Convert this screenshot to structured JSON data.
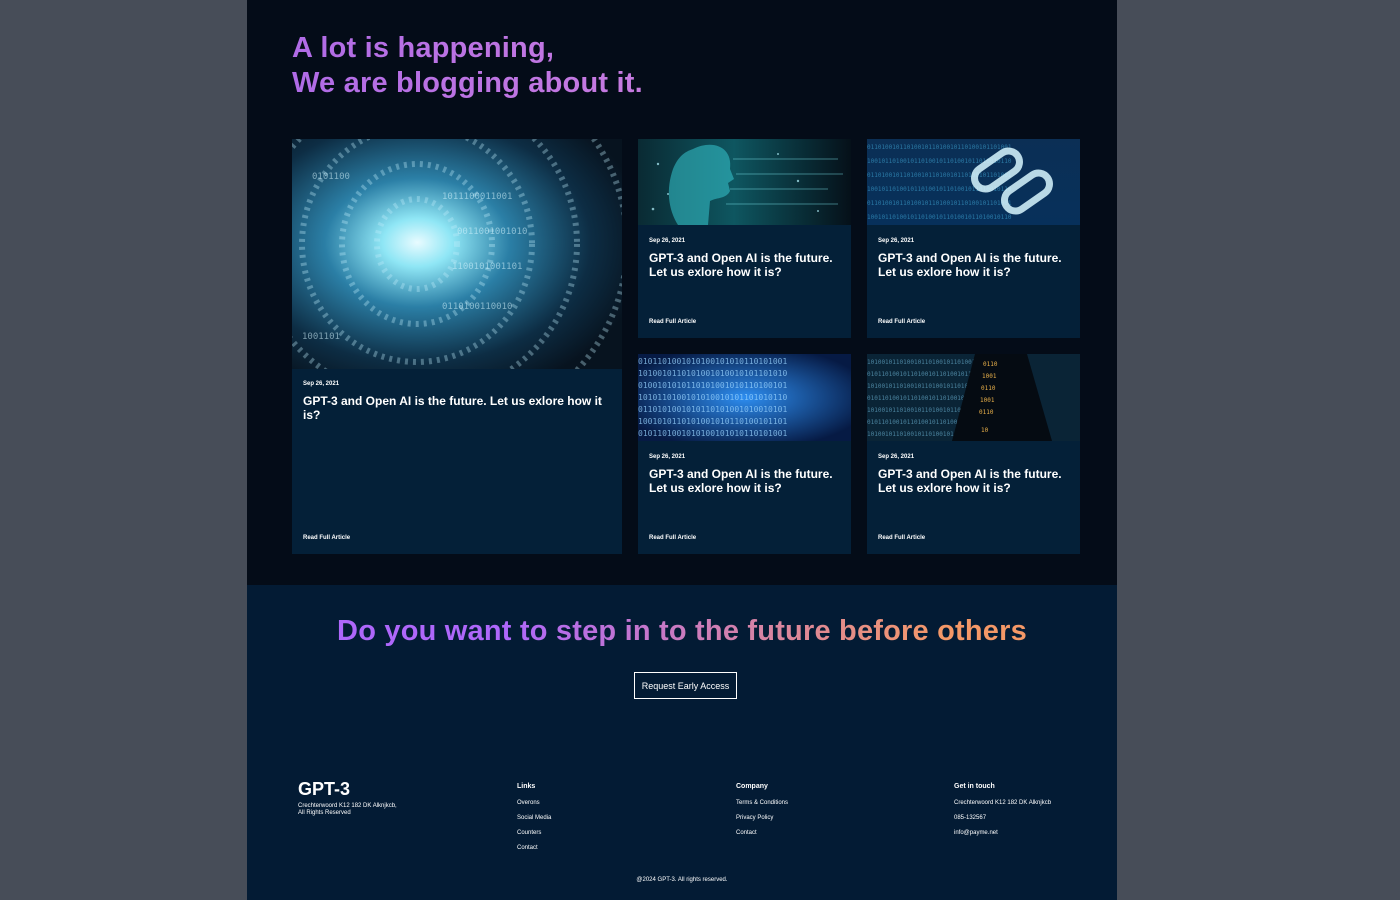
{
  "blog": {
    "title_line1": "A lot is happening,",
    "title_line2": "We are blogging about it.",
    "cards": [
      {
        "date": "Sep 26, 2021",
        "title": "GPT-3 and Open AI is the future. Let us exlore how it is?",
        "link": "Read Full Article",
        "image": "binary-tunnel-image"
      },
      {
        "date": "Sep 26, 2021",
        "title": "GPT-3 and Open AI is the future. Let us exlore how it is?",
        "link": "Read Full Article",
        "image": "ai-face-image"
      },
      {
        "date": "Sep 26, 2021",
        "title": "GPT-3 and Open AI is the future. Let us exlore how it is?",
        "link": "Read Full Article",
        "image": "chain-link-image"
      },
      {
        "date": "Sep 26, 2021",
        "title": "GPT-3 and Open AI is the future. Let us exlore how it is?",
        "link": "Read Full Article",
        "image": "binary-code-image"
      },
      {
        "date": "Sep 26, 2021",
        "title": "GPT-3 and Open AI is the future. Let us exlore how it is?",
        "link": "Read Full Article",
        "image": "binary-warning-image"
      }
    ]
  },
  "cta": {
    "title": "Do you want to step in to the future before others",
    "button": "Request Early Access"
  },
  "footer": {
    "logo": "GPT-3",
    "address_line1": "Crechterwoord K12 182 DK Alknjkcb,",
    "address_line2": "All Rights Reserved",
    "links": {
      "heading": "Links",
      "items": [
        "Overons",
        "Social Media",
        "Counters",
        "Contact"
      ]
    },
    "company": {
      "heading": "Company",
      "items": [
        "Terms & Conditions",
        "Privacy Policy",
        "Contact"
      ]
    },
    "contact": {
      "heading": "Get in touch",
      "items": [
        "Crechterwoord K12 182 DK Alknjkcb",
        "085-132567",
        "info@payme.net"
      ]
    },
    "copyright": "@2024 GPT-3. All rights reserved."
  },
  "colors": {
    "gradient_start": "#ae67fa",
    "gradient_end": "#f49867",
    "bg_dark": "#040c18",
    "bg_card": "#042038"
  }
}
